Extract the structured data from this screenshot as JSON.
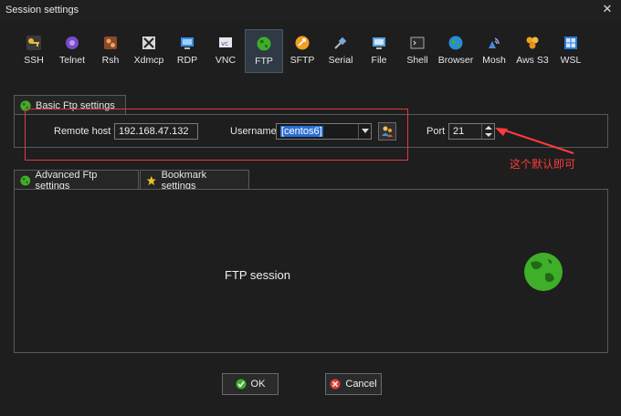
{
  "window": {
    "title": "Session settings",
    "close_glyph": "✕"
  },
  "toolbar": {
    "items": [
      {
        "label": "SSH",
        "icon": "key-icon"
      },
      {
        "label": "Telnet",
        "icon": "telnet-icon"
      },
      {
        "label": "Rsh",
        "icon": "rsh-icon"
      },
      {
        "label": "Xdmcp",
        "icon": "x-icon"
      },
      {
        "label": "RDP",
        "icon": "rdp-icon"
      },
      {
        "label": "VNC",
        "icon": "vnc-icon"
      },
      {
        "label": "FTP",
        "icon": "globe-icon",
        "active": true
      },
      {
        "label": "SFTP",
        "icon": "sftp-icon"
      },
      {
        "label": "Serial",
        "icon": "serial-icon"
      },
      {
        "label": "File",
        "icon": "file-icon"
      },
      {
        "label": "Shell",
        "icon": "shell-icon"
      },
      {
        "label": "Browser",
        "icon": "browser-icon"
      },
      {
        "label": "Mosh",
        "icon": "mosh-icon"
      },
      {
        "label": "Aws S3",
        "icon": "aws-icon"
      },
      {
        "label": "WSL",
        "icon": "wsl-icon"
      }
    ]
  },
  "basic": {
    "tab_label": "Basic Ftp settings",
    "remote_host_label": "Remote host *",
    "remote_host_value": "192.168.47.132",
    "username_label": "Username",
    "username_value": "[centos6]",
    "port_label": "Port",
    "port_value": "21"
  },
  "annotation": {
    "text": "这个默认即可",
    "color": "#ff3b3b"
  },
  "advanced": {
    "tab_advanced_label": "Advanced Ftp settings",
    "tab_bookmark_label": "Bookmark settings",
    "session_text": "FTP session"
  },
  "buttons": {
    "ok_label": "OK",
    "cancel_label": "Cancel"
  },
  "colors": {
    "accent_green": "#3fae2a",
    "selection_blue": "#2a6fd6",
    "active_tab_bg": "#2f3a45"
  }
}
